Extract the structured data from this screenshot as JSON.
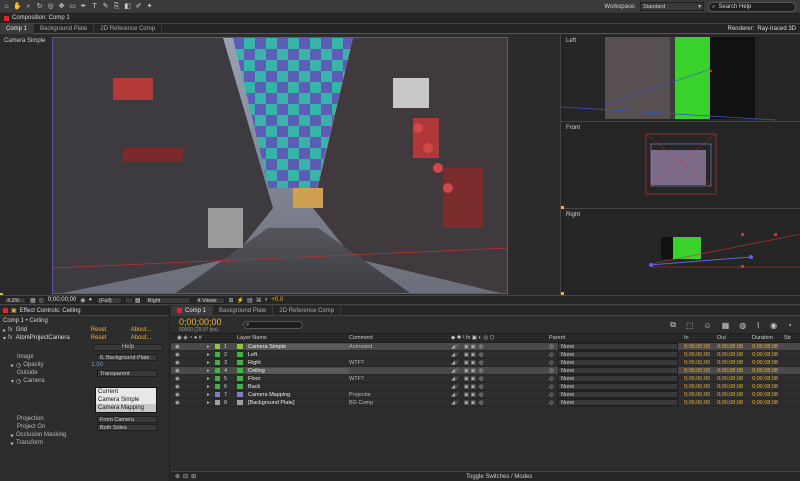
{
  "toolbar": {
    "tools": [
      "home-icon",
      "hand-icon",
      "zoom-icon",
      "rotate-icon",
      "orbit-camera-icon",
      "pan-behind-icon",
      "rectangle-mask-icon",
      "pen-icon",
      "text-icon",
      "brush-icon",
      "clone-stamp-icon",
      "eraser-icon",
      "roto-brush-icon",
      "puppet-pin-icon"
    ],
    "workspace_label": "Workspace:",
    "workspace_value": "Standard",
    "search_placeholder": "Search Help"
  },
  "composition_panel": {
    "panel_title": "Composition: Comp 1",
    "tabs": [
      "Comp 1",
      "Background Plate",
      "2D Reference Comp"
    ],
    "renderer_label": "Renderer:",
    "renderer_value": "Ray-traced 3D",
    "main_view_label": "Camera Simple",
    "side_views": [
      "Left",
      "Front",
      "Right"
    ],
    "footer": {
      "zoom": "4.2%",
      "timecode": "0;00;00;00",
      "resolution": "(Full)",
      "view": "Right",
      "views_count": "4 Views",
      "exposure": "+0.0"
    }
  },
  "effect_controls": {
    "panel_title": "Effect Controls: Ceiling",
    "breadcrumb": "Comp 1 • Ceiling",
    "effects": [
      {
        "name": "Grid",
        "reset": "Reset",
        "about": "About..."
      },
      {
        "name": "AtomProjectCamera",
        "reset": "Reset",
        "about": "About..."
      }
    ],
    "help_label": "Help",
    "image_label": "Image",
    "image_value": "6. Background Plate",
    "opacity_label": "Opacity",
    "opacity_value": "1.00",
    "outside_label": "Outside",
    "outside_value": "Transparent",
    "camera_label": "Camera",
    "camera_options": [
      "Current",
      "Camera Simple",
      "Camera Mapping"
    ],
    "projection_label": "Projection",
    "projection_value": "From Camera",
    "project_on_label": "Project On",
    "project_on_value": "Both Sides",
    "occlusion_label": "Occlusion Masking",
    "transform_label": "Transform"
  },
  "timeline": {
    "tabs": [
      "Comp 1",
      "Background Plate",
      "2D Reference Comp"
    ],
    "timecode": "0;00;00;00",
    "fps": "00000 (29.97 fps)",
    "search_placeholder": "",
    "columns": {
      "layer_name": "Layer Name",
      "comment": "Comment",
      "parent": "Parent",
      "in": "In",
      "out": "Out",
      "duration": "Duration",
      "str": "Str"
    },
    "layers": [
      {
        "num": "1",
        "name": "Camera Simple",
        "comment": "Animated",
        "color": "#8ec63f",
        "parent": "None",
        "in": "0;00;00;00",
        "out": "0;00;08;08",
        "duration": "0;00;08;08",
        "selected": true
      },
      {
        "num": "2",
        "name": "Left",
        "comment": "",
        "color": "#45b045",
        "parent": "None",
        "in": "0;00;00;00",
        "out": "0;00;08;08",
        "duration": "0;00;08;08",
        "selected": false
      },
      {
        "num": "3",
        "name": "Right",
        "comment": "WTF?",
        "color": "#45b045",
        "parent": "None",
        "in": "0;00;00;00",
        "out": "0;00;08;08",
        "duration": "0;00;08;08",
        "selected": false
      },
      {
        "num": "4",
        "name": "Ceiling",
        "comment": "",
        "color": "#45b045",
        "parent": "None",
        "in": "0;00;00;00",
        "out": "0;00;08;08",
        "duration": "0;00;08;08",
        "selected": true
      },
      {
        "num": "5",
        "name": "Floor",
        "comment": "WTF?",
        "color": "#45b045",
        "parent": "None",
        "in": "0;00;00;00",
        "out": "0;00;08;08",
        "duration": "0;00;08;08",
        "selected": false
      },
      {
        "num": "6",
        "name": "Back",
        "comment": "",
        "color": "#45b045",
        "parent": "None",
        "in": "0;00;00;00",
        "out": "0;00;08;08",
        "duration": "0;00;08;08",
        "selected": false
      },
      {
        "num": "7",
        "name": "Camera Mapping",
        "comment": "Projector",
        "color": "#7f7fc6",
        "parent": "None",
        "in": "0;00;00;00",
        "out": "0;00;08;08",
        "duration": "0;00;08;08",
        "selected": false
      },
      {
        "num": "8",
        "name": "[Background Plate]",
        "comment": "BG Comp",
        "color": "#a0a0a0",
        "parent": "None",
        "in": "0;00;00;00",
        "out": "0;00;08;08",
        "duration": "0;00;08;08",
        "selected": false
      }
    ],
    "toggle_label": "Toggle Switches / Modes"
  }
}
